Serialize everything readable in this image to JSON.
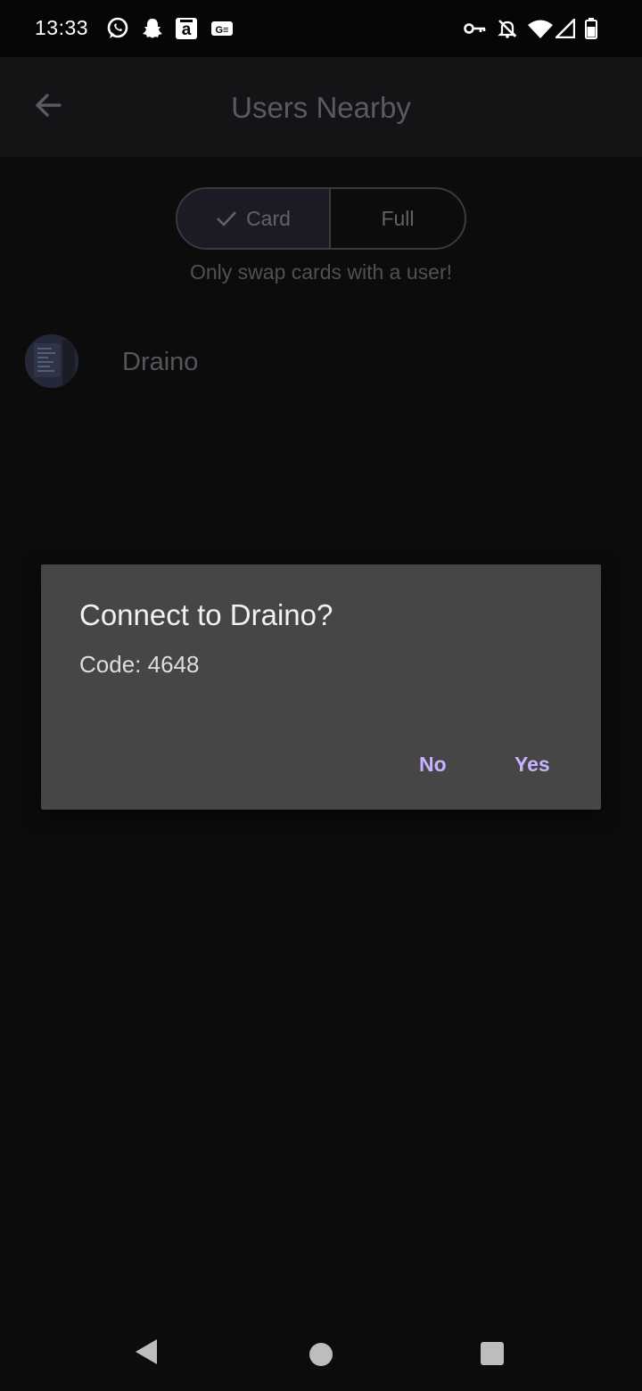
{
  "status_bar": {
    "time": "13:33",
    "left_icons": [
      "whatsapp-icon",
      "snapchat-icon",
      "amazon-icon",
      "translate-icon"
    ],
    "right_icons": [
      "vpn-key-icon",
      "notifications-off-icon",
      "wifi-icon",
      "signal-icon",
      "battery-icon"
    ]
  },
  "app_bar": {
    "title": "Users Nearby",
    "back_icon": "arrow-back-icon"
  },
  "mode_toggle": {
    "options": [
      "Card",
      "Full"
    ],
    "selected": "Card",
    "hint": "Only swap cards with a user!"
  },
  "users": [
    {
      "name": "Draino"
    }
  ],
  "dialog": {
    "title": "Connect to Draino?",
    "message": "Code: 4648",
    "negative": "No",
    "positive": "Yes",
    "accent_color": "#c7b3ff"
  },
  "nav_bar": {
    "icons": [
      "back-icon",
      "home-icon",
      "recents-icon"
    ]
  },
  "colors": {
    "background": "#0c0c0d",
    "dialog": "#464646",
    "app_bar": "#141416"
  }
}
